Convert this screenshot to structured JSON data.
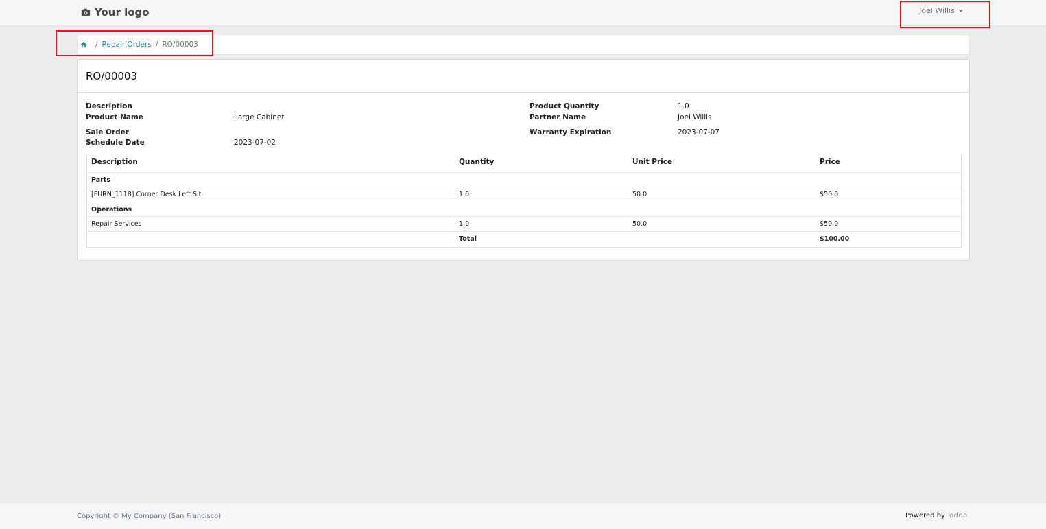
{
  "header": {
    "logo_text": "Your logo",
    "logo_icon": "camera-icon",
    "user_name": "Joel Willis"
  },
  "breadcrumb": {
    "home_icon": "home-icon",
    "separator": "/",
    "items": [
      "Repair Orders",
      "RO/00003"
    ]
  },
  "order": {
    "title": "RO/00003",
    "fields": {
      "description_label": "Description",
      "description_value": "",
      "product_name_label": "Product Name",
      "product_name_value": "Large Cabinet",
      "sale_order_label": "Sale Order",
      "sale_order_value": "",
      "schedule_date_label": "Schedule Date",
      "schedule_date_value": "2023-07-02",
      "product_quantity_label": "Product Quantity",
      "product_quantity_value": "1.0",
      "partner_name_label": "Partner Name",
      "partner_name_value": "Joel Willis",
      "warranty_expiration_label": "Warranty Expiration",
      "warranty_expiration_value": "2023-07-07"
    },
    "lines": {
      "columns": [
        "Description",
        "Quantity",
        "Unit Price",
        "Price"
      ],
      "parts_section": "Parts",
      "parts": [
        {
          "description": "[FURN_1118] Corner Desk Left Sit",
          "quantity": "1.0",
          "unit_price": "50.0",
          "price": "$50.0"
        }
      ],
      "operations_section": "Operations",
      "operations": [
        {
          "description": "Repair Services",
          "quantity": "1.0",
          "unit_price": "50.0",
          "price": "$50.0"
        }
      ],
      "total_label": "Total",
      "total_value": "$100.00"
    }
  },
  "footer": {
    "copyright": "Copyright © My Company (San Francisco)",
    "powered_by": "Powered by",
    "brand": "odoo"
  },
  "colors": {
    "link": "#2b8a9e",
    "highlight": "#e8141b",
    "background": "#ececec"
  }
}
